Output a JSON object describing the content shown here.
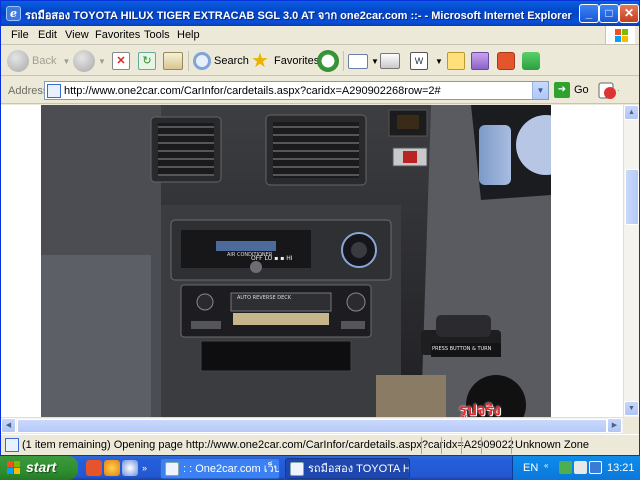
{
  "window": {
    "title": "รถมือสอง TOYOTA HILUX TIGER EXTRACAB SGL 3.0 AT จาก one2car.com ::- - Microsoft Internet Explorer",
    "min_label": "_",
    "max_label": "□",
    "close_label": "✕"
  },
  "menu": [
    "File",
    "Edit",
    "View",
    "Favorites",
    "Tools",
    "Help"
  ],
  "toolbar": {
    "back": "Back",
    "search": "Search",
    "favorites": "Favorites"
  },
  "address": {
    "label": "Address",
    "url": "http://www.one2car.com/CarInfor/cardetails.aspx?caridx=A290902268row=2#",
    "go": "Go"
  },
  "content": {
    "image_subject": "car-dashboard-photo",
    "radio_text_1": "AUTO REVERSE DECK",
    "ac_label": "AIR CONDITIONER",
    "sticker_text": "PRESS BUTTON & TURN",
    "ac_fan_labels": "OFF LO ▪ ▪ HI",
    "watermark": "รูปจริง"
  },
  "status": {
    "text": "(1 item remaining) Opening page http://www.one2car.com/CarInfor/cardetails.aspx?caridx=A2909022",
    "zone": "Unknown Zone"
  },
  "taskbar": {
    "start": "start",
    "tasks": [
      {
        "label": ": : One2car.com เว็บ...",
        "active": false
      },
      {
        "label": "รถมือสอง TOYOTA HI...",
        "active": true
      }
    ],
    "lang": "EN",
    "clock": "13:21"
  }
}
